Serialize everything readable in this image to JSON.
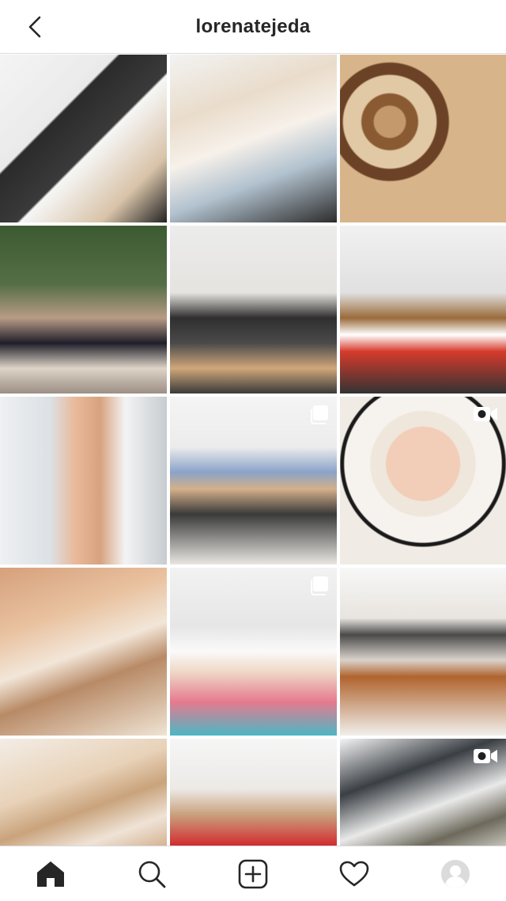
{
  "header": {
    "username": "lorenatejeda",
    "back_icon": "chevron-left-icon"
  },
  "grid": {
    "posts": [
      {
        "type": "photo"
      },
      {
        "type": "photo"
      },
      {
        "type": "photo"
      },
      {
        "type": "photo"
      },
      {
        "type": "photo"
      },
      {
        "type": "photo"
      },
      {
        "type": "photo"
      },
      {
        "type": "carousel",
        "badge_icon": "multiple-images-icon"
      },
      {
        "type": "video",
        "badge_icon": "video-camera-icon"
      },
      {
        "type": "photo"
      },
      {
        "type": "carousel",
        "badge_icon": "multiple-images-icon"
      },
      {
        "type": "photo"
      },
      {
        "type": "photo"
      },
      {
        "type": "photo"
      },
      {
        "type": "video",
        "badge_icon": "video-camera-icon"
      }
    ]
  },
  "bottom_nav": {
    "items": [
      {
        "icon": "home-icon",
        "active": true
      },
      {
        "icon": "search-icon",
        "active": false
      },
      {
        "icon": "add-post-icon",
        "active": false
      },
      {
        "icon": "heart-icon",
        "active": false
      },
      {
        "icon": "profile-avatar-icon",
        "active": false
      }
    ]
  }
}
